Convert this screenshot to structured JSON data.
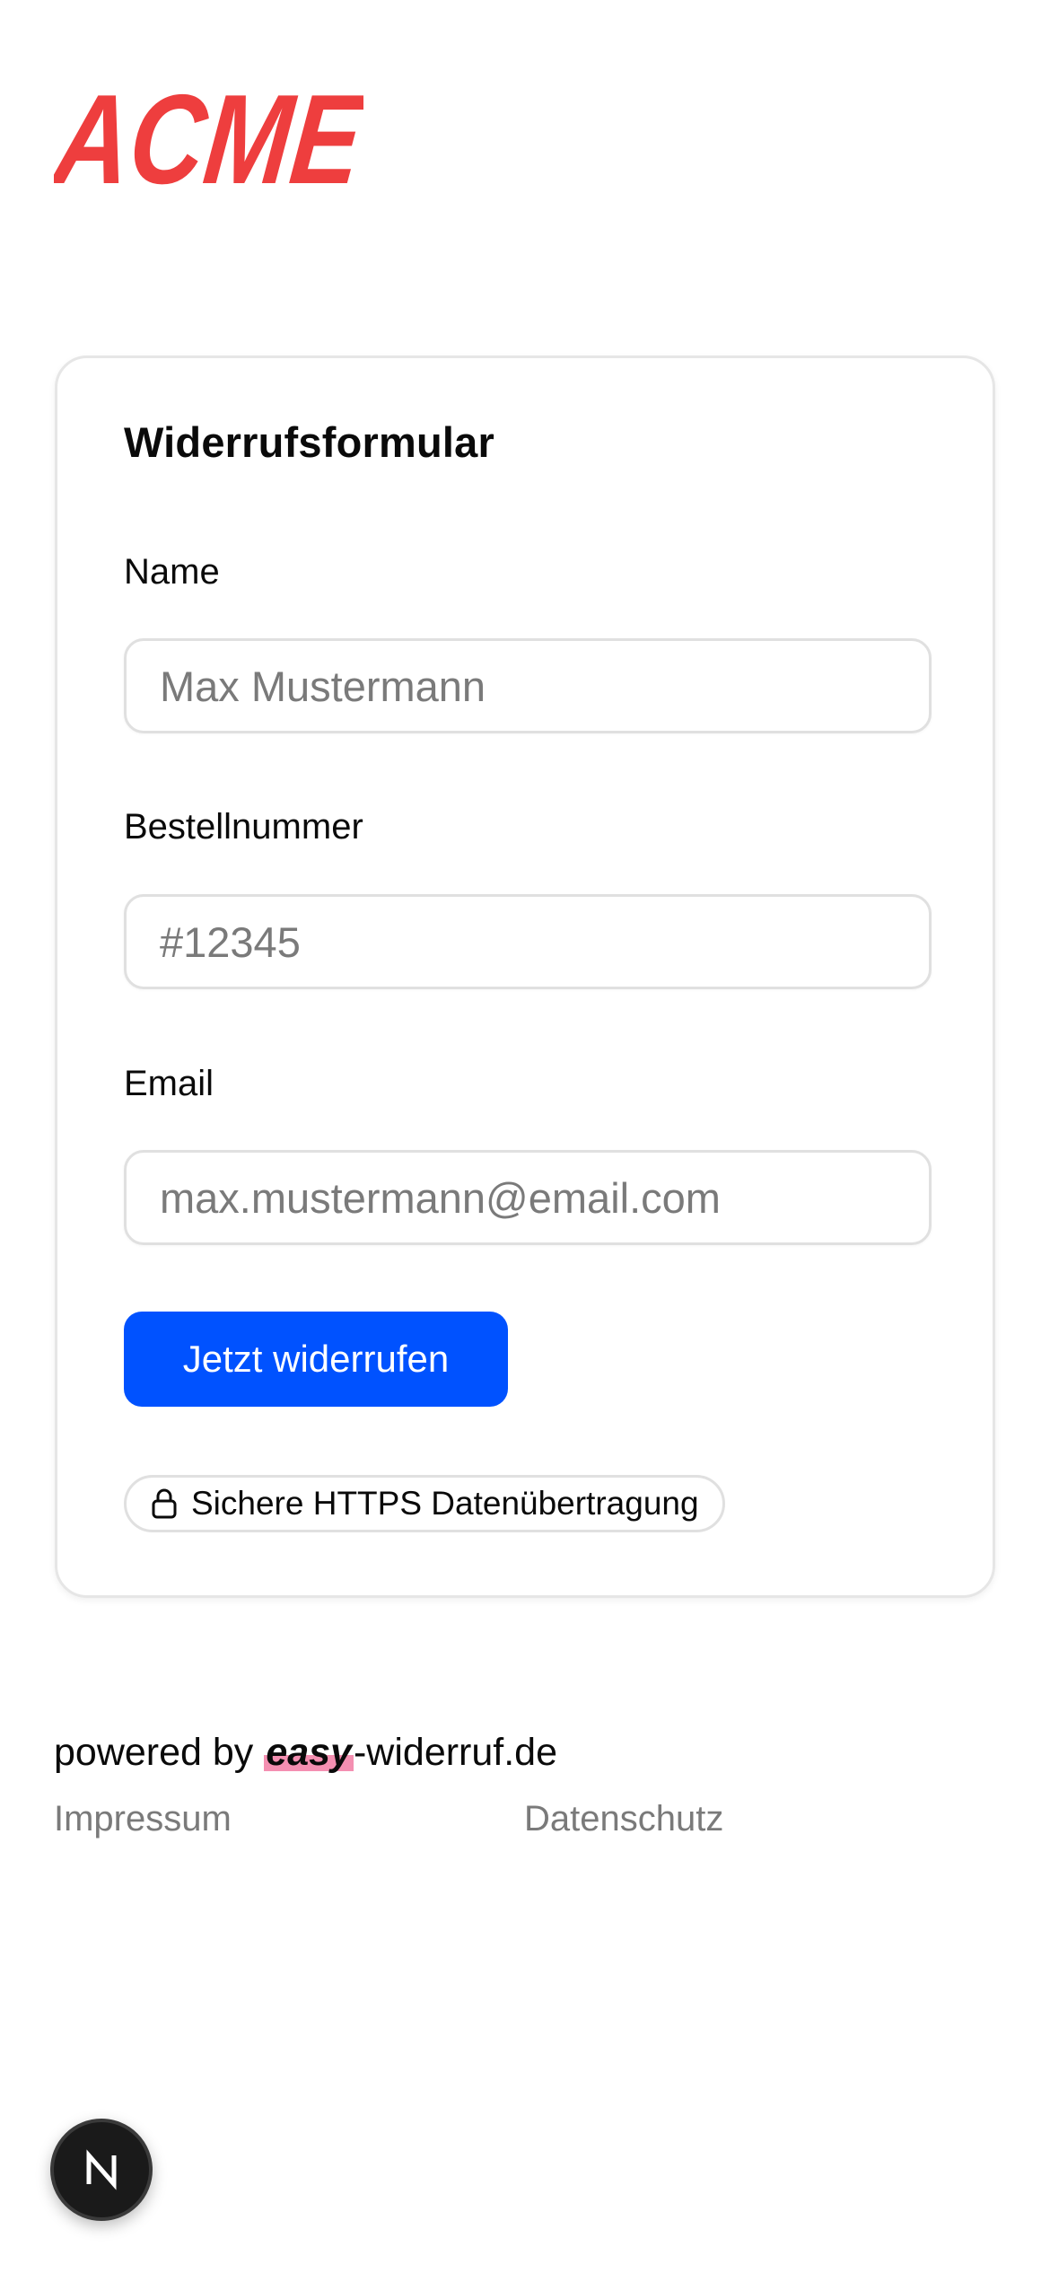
{
  "brand": {
    "logo_text": "ACME",
    "logo_color": "#ee3e3e"
  },
  "form": {
    "title": "Widerrufsformular",
    "fields": [
      {
        "label": "Name",
        "placeholder": "Max Mustermann",
        "value": ""
      },
      {
        "label": "Bestellnummer",
        "placeholder": "#12345",
        "value": ""
      },
      {
        "label": "Email",
        "placeholder": "max.mustermann@email.com",
        "value": ""
      }
    ],
    "submit_label": "Jetzt widerrufen",
    "submit_color": "#0052ff",
    "https_badge": {
      "icon": "lock-icon",
      "text": "Sichere HTTPS Datenübertragung"
    }
  },
  "footer": {
    "powered_prefix": "powered by",
    "powered_brand": "easy",
    "powered_suffix": "-widerruf.de",
    "highlight_color": "#f48fb1",
    "links": [
      "Impressum",
      "Datenschutz"
    ]
  },
  "dev_badge": {
    "icon": "nextjs-n-icon",
    "letter": "N"
  }
}
